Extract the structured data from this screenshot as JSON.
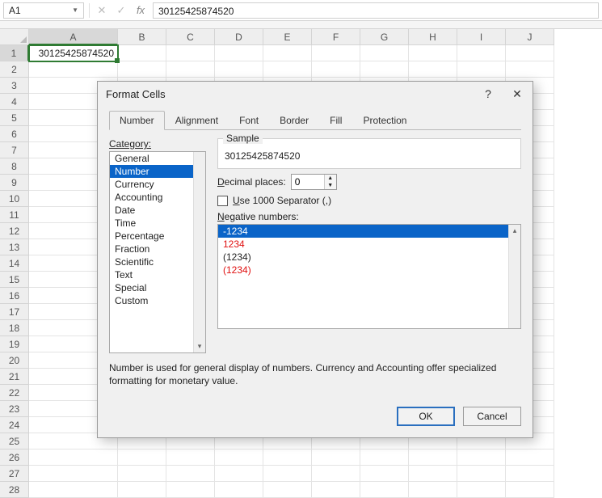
{
  "name_box": "A1",
  "active_cell_value": "30125425874520",
  "formula_value": "30125425874520",
  "columns": [
    "A",
    "B",
    "C",
    "D",
    "E",
    "F",
    "G",
    "H",
    "I",
    "J"
  ],
  "row_count": 28,
  "dialog": {
    "title": "Format Cells",
    "help_char": "?",
    "close_char": "✕",
    "tabs": [
      "Number",
      "Alignment",
      "Font",
      "Border",
      "Fill",
      "Protection"
    ],
    "active_tab": "Number",
    "category_label": "Category:",
    "categories": [
      "General",
      "Number",
      "Currency",
      "Accounting",
      "Date",
      "Time",
      "Percentage",
      "Fraction",
      "Scientific",
      "Text",
      "Special",
      "Custom"
    ],
    "selected_category": "Number",
    "sample_label": "Sample",
    "sample_value": "30125425874520",
    "decimal_label": "Decimal places:",
    "decimal_value": "0",
    "use_sep_label": "Use 1000 Separator (,)",
    "use_sep_checked": false,
    "neg_label": "Negative numbers:",
    "neg_options": [
      {
        "text": "-1234",
        "red": false
      },
      {
        "text": "1234",
        "red": true
      },
      {
        "text": "(1234)",
        "red": false
      },
      {
        "text": "(1234)",
        "red": true
      }
    ],
    "neg_selected_index": 0,
    "description": "Number is used for general display of numbers.  Currency and Accounting offer specialized formatting for monetary value.",
    "ok_label": "OK",
    "cancel_label": "Cancel"
  }
}
